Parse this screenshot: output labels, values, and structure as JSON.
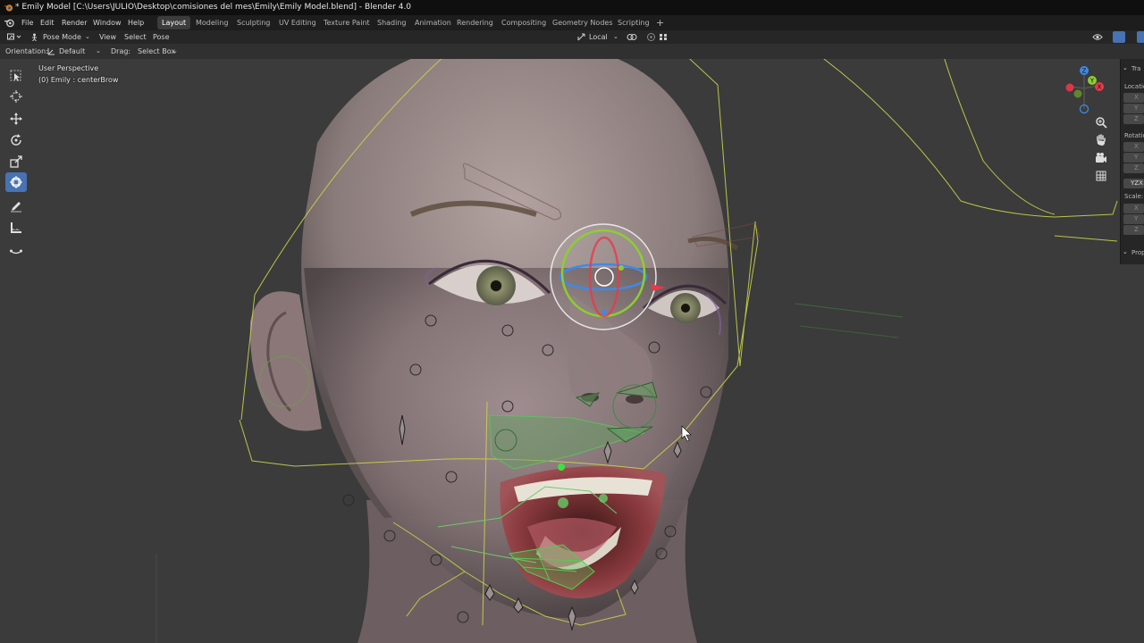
{
  "window": {
    "title": "* Emily Model [C:\\Users\\JULIO\\Desktop\\comisiones del mes\\Emily\\Emily Model.blend] - Blender 4.0"
  },
  "menu": {
    "file": "File",
    "edit": "Edit",
    "render": "Render",
    "window": "Window",
    "help": "Help"
  },
  "workspaces": [
    {
      "label": "Layout",
      "active": true
    },
    {
      "label": "Modeling"
    },
    {
      "label": "Sculpting"
    },
    {
      "label": "UV Editing"
    },
    {
      "label": "Texture Paint"
    },
    {
      "label": "Shading"
    },
    {
      "label": "Animation"
    },
    {
      "label": "Rendering"
    },
    {
      "label": "Compositing"
    },
    {
      "label": "Geometry Nodes"
    },
    {
      "label": "Scripting"
    }
  ],
  "add_workspace": "+",
  "header": {
    "mode": "Pose Mode",
    "view": "View",
    "select": "Select",
    "pose": "Pose",
    "transform_orientation": "Local"
  },
  "toolsettings": {
    "orientation_label": "Orientation:",
    "orientation_value": "Default",
    "drag_label": "Drag:",
    "drag_value": "Select Box"
  },
  "viewport": {
    "perspective": "User Perspective",
    "active_object": "(0) Emily : centerBrow"
  },
  "gizmo": {
    "x": "X",
    "y": "Y",
    "z": "Z"
  },
  "sidebar": {
    "transform_header": "Tra",
    "location": "Locatio",
    "rotation": "Rotatio",
    "rotation_mode": "YZX",
    "scale": "Scale:",
    "properties": "Prop",
    "x": "X",
    "y": "Y",
    "z": "Z"
  },
  "colors": {
    "active_blue": "#4772b3",
    "rig_yellow": "#c9d44a",
    "bone_green": "#5fbf5f",
    "gizmo_red": "#e8394a",
    "gizmo_green": "#8bcf2f",
    "gizmo_blue": "#3d8ae8"
  }
}
